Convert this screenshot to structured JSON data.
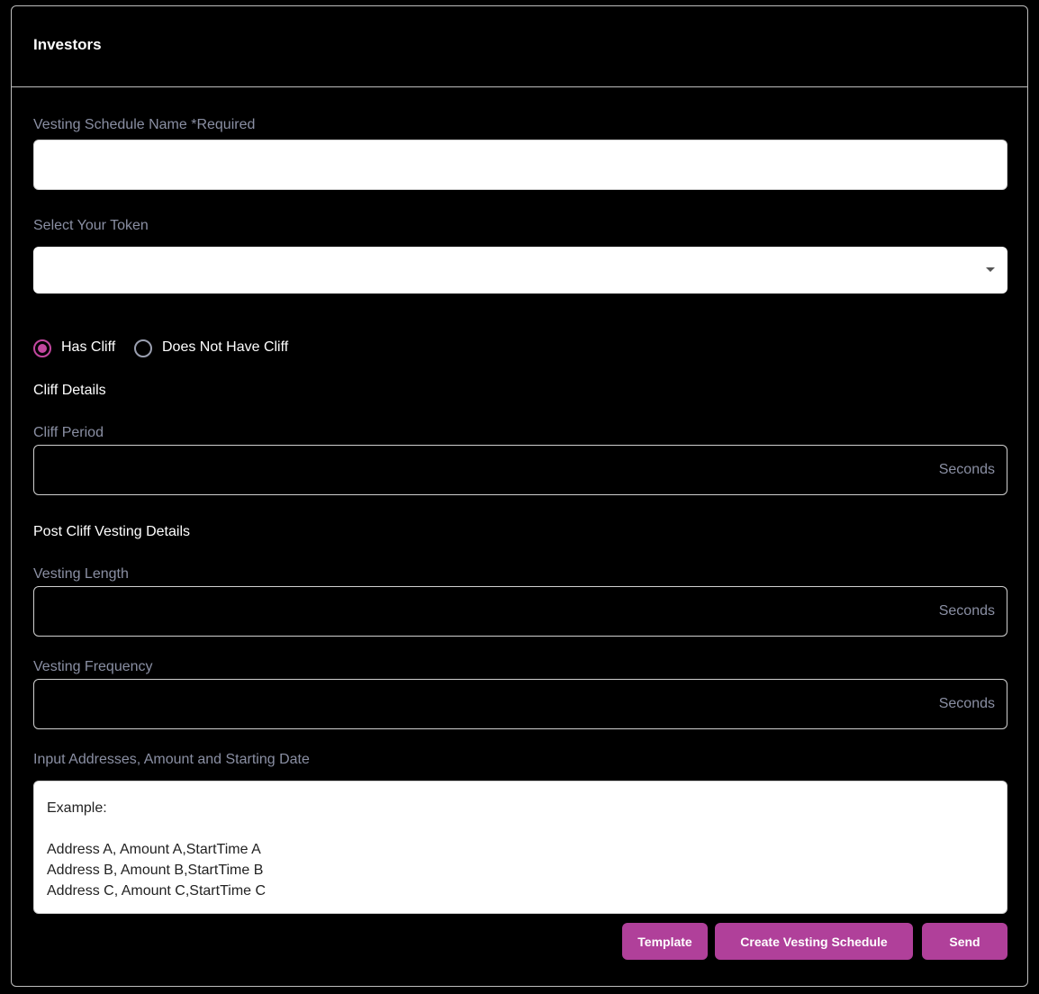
{
  "header": {
    "title": "Investors"
  },
  "form": {
    "schedule_name": {
      "label": "Vesting Schedule Name *Required",
      "value": ""
    },
    "token": {
      "label": "Select Your Token",
      "selected": ""
    },
    "cliff_options": [
      {
        "label": "Has Cliff",
        "checked": true
      },
      {
        "label": "Does Not Have Cliff",
        "checked": false
      }
    ],
    "cliff_section": {
      "title": "Cliff Details"
    },
    "cliff_period": {
      "label": "Cliff Period",
      "value": "",
      "suffix": "Seconds"
    },
    "post_cliff_section": {
      "title": "Post Cliff Vesting Details"
    },
    "vesting_length": {
      "label": "Vesting Length",
      "value": "",
      "suffix": "Seconds"
    },
    "vesting_frequency": {
      "label": "Vesting Frequency",
      "value": "",
      "suffix": "Seconds"
    },
    "addresses": {
      "label": "Input Addresses, Amount and Starting Date",
      "placeholder_lines": [
        "Example:",
        "",
        "Address A, Amount A,StartTime A",
        "Address B, Amount B,StartTime B",
        "Address C, Amount C,StartTime C"
      ]
    }
  },
  "actions": {
    "template_label": "Template",
    "create_label": "Create Vesting Schedule",
    "send_label": "Send"
  },
  "colors": {
    "accent": "#c2479f",
    "button": "#b0409a",
    "muted_text": "#8a8fa3",
    "background": "#000000"
  }
}
